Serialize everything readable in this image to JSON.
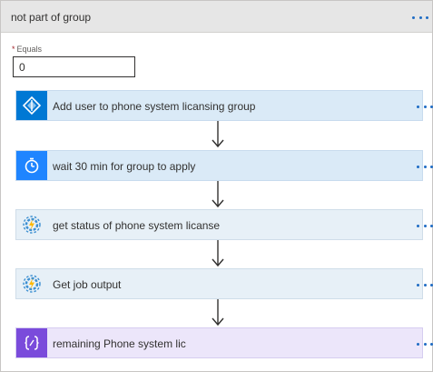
{
  "scope": {
    "title": "not part of group"
  },
  "condition": {
    "label": "Equals",
    "required_marker": "*",
    "value": "0"
  },
  "actions": [
    {
      "title": "Add user to phone system licansing group",
      "icon": "azure-ad-icon",
      "color": "#0078d4"
    },
    {
      "title": "wait 30 min for group to apply",
      "icon": "timer-icon",
      "color": "#1f85ff"
    },
    {
      "title": "get status of phone system licanse",
      "icon": "automation-gear-icon",
      "color": "#4a90c8"
    },
    {
      "title": "Get job output",
      "icon": "automation-gear-icon",
      "color": "#4a90c8"
    },
    {
      "title": "remaining Phone system lic",
      "icon": "variable-icon",
      "color": "#7a4bdb"
    }
  ]
}
